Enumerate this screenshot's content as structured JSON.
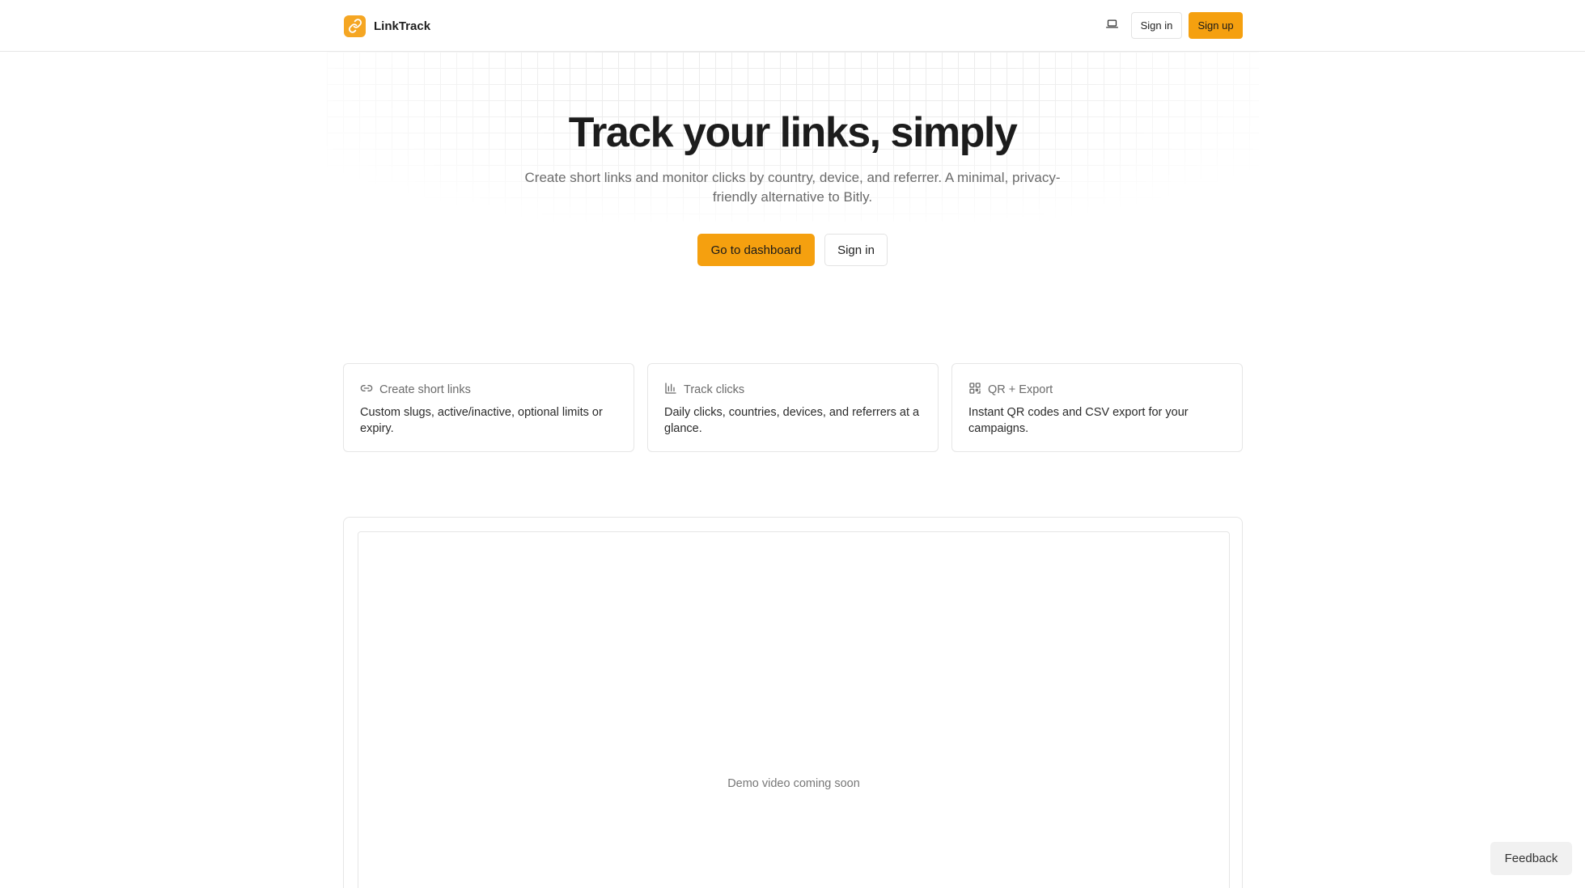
{
  "brand": {
    "name": "LinkTrack",
    "logo_icon": "link-icon",
    "accent": "#f5a00f"
  },
  "header": {
    "theme_icon": "laptop-icon",
    "signin_label": "Sign in",
    "signup_label": "Sign up"
  },
  "hero": {
    "title": "Track your links, simply",
    "subtitle": "Create short links and monitor clicks by country, device, and referrer. A minimal, privacy-friendly alternative to Bitly.",
    "primary_cta": "Go to dashboard",
    "secondary_cta": "Sign in"
  },
  "features": [
    {
      "icon": "link-icon",
      "title": "Create short links",
      "description": "Custom slugs, active/inactive, optional limits or expiry."
    },
    {
      "icon": "bar-chart-icon",
      "title": "Track clicks",
      "description": "Daily clicks, countries, devices, and referrers at a glance."
    },
    {
      "icon": "qr-code-icon",
      "title": "QR + Export",
      "description": "Instant QR codes and CSV export for your campaigns."
    }
  ],
  "demo": {
    "placeholder": "Demo video coming soon"
  },
  "feedback": {
    "label": "Feedback"
  }
}
